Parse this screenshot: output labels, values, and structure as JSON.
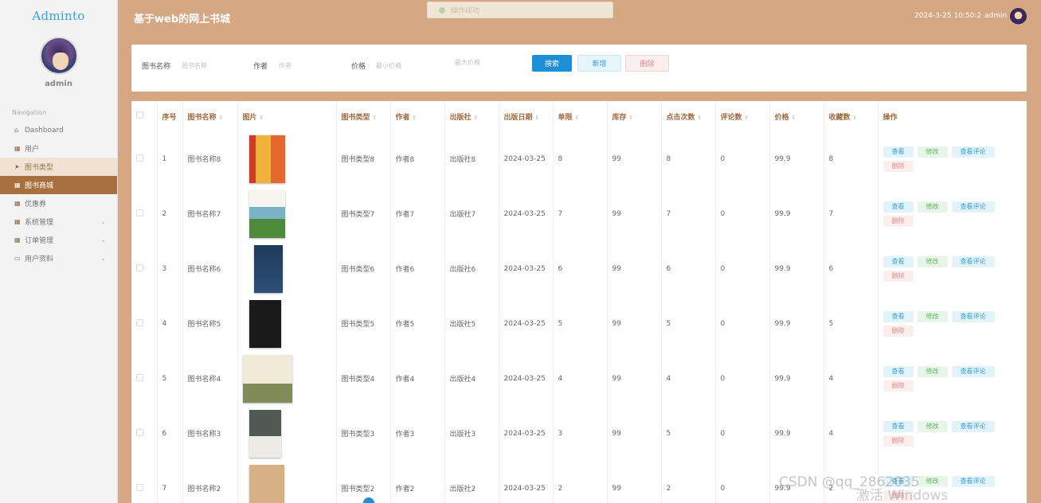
{
  "sidebar": {
    "logo": "Adminto",
    "username": "admin",
    "nav_caption": "Navigation",
    "items": [
      {
        "label": "Dashboard",
        "icon": "home-icon"
      },
      {
        "label": "用户",
        "icon": "grid-icon"
      },
      {
        "label": "图书类型",
        "icon": "send-icon"
      },
      {
        "label": "图书商城",
        "icon": "grid-icon"
      },
      {
        "label": "优惠券",
        "icon": "grid-icon"
      },
      {
        "label": "系统管理",
        "icon": "grid-icon"
      },
      {
        "label": "订单管理",
        "icon": "grid-icon"
      },
      {
        "label": "用户资料",
        "icon": "calendar-icon"
      }
    ]
  },
  "header": {
    "title": "基于web的网上书城",
    "toast": "操作成功",
    "datetime": "2024-3-25 10:50:2",
    "user": "admin"
  },
  "search": {
    "name_label": "图书名称",
    "name_placeholder": "图书名称",
    "author_label": "作者",
    "author_placeholder": "作者",
    "price_label": "价格",
    "min_price_placeholder": "最小价格",
    "max_price_placeholder": "最大价格",
    "search_button": "搜索",
    "add_button": "新增",
    "delete_button": "删除"
  },
  "table": {
    "columns": [
      "序号",
      "图书名称",
      "图片",
      "图书类型",
      "作者",
      "出版社",
      "出版日期",
      "单限",
      "库存",
      "点击次数",
      "评论数",
      "价格",
      "收藏数",
      "操作"
    ],
    "actions": {
      "view": "查看",
      "edit": "修改",
      "comments": "查看评论",
      "delete": "删除"
    },
    "rows": [
      {
        "index": "1",
        "name": "图书名称8",
        "type": "图书类型8",
        "author": "作者8",
        "publisher": "出版社8",
        "date": "2024-03-25",
        "limit": "8",
        "stock": "99",
        "clicks": "8",
        "comments": "0",
        "price": "99.9",
        "favorites": "8"
      },
      {
        "index": "2",
        "name": "图书名称7",
        "type": "图书类型7",
        "author": "作者7",
        "publisher": "出版社7",
        "date": "2024-03-25",
        "limit": "7",
        "stock": "99",
        "clicks": "7",
        "comments": "0",
        "price": "99.9",
        "favorites": "7"
      },
      {
        "index": "3",
        "name": "图书名称6",
        "type": "图书类型6",
        "author": "作者6",
        "publisher": "出版社6",
        "date": "2024-03-25",
        "limit": "6",
        "stock": "99",
        "clicks": "6",
        "comments": "0",
        "price": "99.9",
        "favorites": "6"
      },
      {
        "index": "4",
        "name": "图书名称5",
        "type": "图书类型5",
        "author": "作者5",
        "publisher": "出版社5",
        "date": "2024-03-25",
        "limit": "5",
        "stock": "99",
        "clicks": "5",
        "comments": "0",
        "price": "99.9",
        "favorites": "5"
      },
      {
        "index": "5",
        "name": "图书名称4",
        "type": "图书类型4",
        "author": "作者4",
        "publisher": "出版社4",
        "date": "2024-03-25",
        "limit": "4",
        "stock": "99",
        "clicks": "4",
        "comments": "0",
        "price": "99.9",
        "favorites": "4"
      },
      {
        "index": "6",
        "name": "图书名称3",
        "type": "图书类型3",
        "author": "作者3",
        "publisher": "出版社3",
        "date": "2024-03-25",
        "limit": "3",
        "stock": "99",
        "clicks": "5",
        "comments": "0",
        "price": "99.9",
        "favorites": "4"
      },
      {
        "index": "7",
        "name": "图书名称2",
        "type": "图书类型2",
        "author": "作者2",
        "publisher": "出版社2",
        "date": "2024-03-25",
        "limit": "2",
        "stock": "99",
        "clicks": "2",
        "comments": "0",
        "price": "99.9",
        "favorites": "2"
      }
    ]
  },
  "watermark": "CSDN @qq_2862035",
  "watermark_os": "激活 Windows"
}
